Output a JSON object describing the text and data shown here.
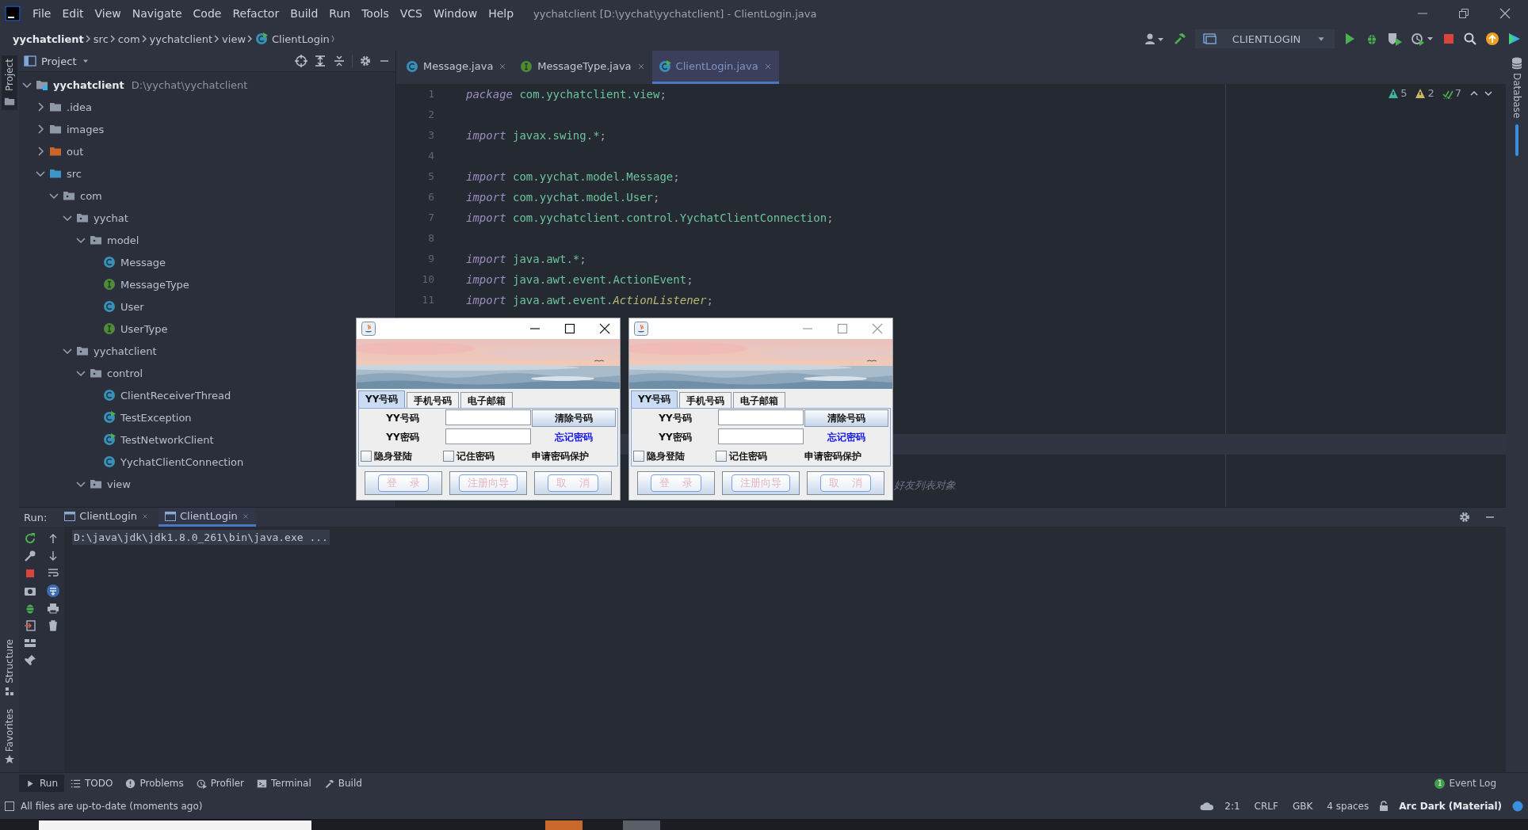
{
  "menu_bar": {
    "menus": [
      "File",
      "Edit",
      "View",
      "Navigate",
      "Code",
      "Refactor",
      "Build",
      "Run",
      "Tools",
      "VCS",
      "Window",
      "Help"
    ],
    "title": "yychatclient [D:\\yychat\\yychatclient] - ClientLogin.java"
  },
  "nav_bar": {
    "breadcrumbs": [
      {
        "label": "yychatclient",
        "kind": "module"
      },
      {
        "label": "src",
        "kind": "folder"
      },
      {
        "label": "com",
        "kind": "folder"
      },
      {
        "label": "yychatclient",
        "kind": "folder"
      },
      {
        "label": "view",
        "kind": "folder"
      },
      {
        "label": "ClientLogin",
        "kind": "runnable"
      }
    ],
    "run_config": "CLIENTLOGIN"
  },
  "left_stripe": {
    "top": [
      "Project"
    ],
    "bottom": [
      "Structure",
      "Favorites"
    ]
  },
  "right_stripe": [
    "Database"
  ],
  "project_panel": {
    "title": "Project",
    "tree": [
      {
        "label": "yychatclient",
        "path": "D:\\yychat\\yychatclient",
        "kind": "module",
        "expanded": true,
        "children": [
          {
            "label": ".idea",
            "kind": "folder",
            "expanded": false
          },
          {
            "label": "images",
            "kind": "folder",
            "expanded": false
          },
          {
            "label": "out",
            "kind": "excluded",
            "expanded": false
          },
          {
            "label": "src",
            "kind": "source",
            "expanded": true,
            "children": [
              {
                "label": "com",
                "kind": "package",
                "expanded": true,
                "children": [
                  {
                    "label": "yychat",
                    "kind": "package",
                    "expanded": true,
                    "children": [
                      {
                        "label": "model",
                        "kind": "package",
                        "expanded": true,
                        "children": [
                          {
                            "label": "Message",
                            "kind": "class"
                          },
                          {
                            "label": "MessageType",
                            "kind": "interface"
                          },
                          {
                            "label": "User",
                            "kind": "class"
                          },
                          {
                            "label": "UserType",
                            "kind": "interface"
                          }
                        ]
                      }
                    ]
                  },
                  {
                    "label": "yychatclient",
                    "kind": "package",
                    "expanded": true,
                    "children": [
                      {
                        "label": "control",
                        "kind": "package",
                        "expanded": true,
                        "children": [
                          {
                            "label": "ClientReceiverThread",
                            "kind": "class"
                          },
                          {
                            "label": "TestException",
                            "kind": "runnable"
                          },
                          {
                            "label": "TestNetworkClient",
                            "kind": "runnable"
                          },
                          {
                            "label": "YychatClientConnection",
                            "kind": "class"
                          }
                        ]
                      },
                      {
                        "label": "view",
                        "kind": "package",
                        "expanded": true
                      }
                    ]
                  }
                ]
              }
            ]
          }
        ]
      }
    ]
  },
  "editor": {
    "tabs": [
      {
        "label": "Message.java",
        "kind": "class",
        "selected": false
      },
      {
        "label": "MessageType.java",
        "kind": "interface",
        "selected": false
      },
      {
        "label": "ClientLogin.java",
        "kind": "runnable",
        "selected": true
      }
    ],
    "inspections": [
      {
        "kind": "error",
        "count": "5"
      },
      {
        "kind": "warning",
        "count": "2"
      },
      {
        "kind": "typo",
        "count": "7"
      }
    ],
    "lines": [
      {
        "number": "1",
        "tokens": [
          {
            "kind": "keyword",
            "text": "package"
          },
          {
            "kind": "ident",
            "text": " com.yychatclient.view"
          },
          {
            "kind": "punct",
            "text": ";"
          }
        ]
      },
      {
        "number": "2"
      },
      {
        "number": "3",
        "tokens": [
          {
            "kind": "keyword",
            "text": "import"
          },
          {
            "kind": "ident",
            "text": " javax.swing.*"
          },
          {
            "kind": "punct",
            "text": ";"
          }
        ]
      },
      {
        "number": "4"
      },
      {
        "number": "5",
        "tokens": [
          {
            "kind": "keyword",
            "text": "import"
          },
          {
            "kind": "ident",
            "text": " com.yychat.model.Message"
          },
          {
            "kind": "punct",
            "text": ";"
          }
        ]
      },
      {
        "number": "6",
        "tokens": [
          {
            "kind": "keyword",
            "text": "import"
          },
          {
            "kind": "ident",
            "text": " com.yychat.model.User"
          },
          {
            "kind": "punct",
            "text": ";"
          }
        ]
      },
      {
        "number": "7",
        "tokens": [
          {
            "kind": "keyword",
            "text": "import"
          },
          {
            "kind": "ident",
            "text": " com.yychatclient.control.YychatClientConnection"
          },
          {
            "kind": "punct",
            "text": ";"
          }
        ]
      },
      {
        "number": "8"
      },
      {
        "number": "9",
        "tokens": [
          {
            "kind": "keyword",
            "text": "import"
          },
          {
            "kind": "ident",
            "text": " java.awt.*"
          },
          {
            "kind": "punct",
            "text": ";"
          }
        ]
      },
      {
        "number": "10",
        "tokens": [
          {
            "kind": "keyword",
            "text": "import"
          },
          {
            "kind": "ident",
            "text": " java.awt.event.ActionEvent"
          },
          {
            "kind": "punct",
            "text": ";"
          }
        ]
      },
      {
        "number": "11",
        "tokens": [
          {
            "kind": "keyword",
            "text": "import"
          },
          {
            "kind": "ident",
            "text": " java.awt.event."
          },
          {
            "kind": "type",
            "text": "ActionListener"
          },
          {
            "kind": "punct",
            "text": ";"
          }
        ]
      }
    ],
    "comment_fragment": "好友列表对象"
  },
  "login_windows": [
    {
      "active": true,
      "tabs": [
        {
          "label": "YY号码",
          "selected": true
        },
        {
          "label": "手机号码",
          "selected": false
        },
        {
          "label": "电子邮箱",
          "selected": false
        }
      ],
      "fields": [
        {
          "label": "YY号码",
          "kind": "button",
          "action": "清除号码"
        },
        {
          "label": "YY密码",
          "kind": "link",
          "action": "忘记密码"
        }
      ],
      "options": [
        {
          "label": "隐身登陆",
          "kind": "checkbox",
          "checked": false
        },
        {
          "label": "记住密码",
          "kind": "checkbox",
          "checked": false
        },
        {
          "label": "申请密码保护",
          "kind": "text"
        }
      ],
      "buttons": [
        "登 录",
        "注册向导",
        "取 消"
      ]
    },
    {
      "active": false,
      "tabs": [
        {
          "label": "YY号码",
          "selected": true
        },
        {
          "label": "手机号码",
          "selected": false
        },
        {
          "label": "电子邮箱",
          "selected": false
        }
      ],
      "fields": [
        {
          "label": "YY号码",
          "kind": "button",
          "action": "清除号码"
        },
        {
          "label": "YY密码",
          "kind": "link",
          "action": "忘记密码"
        }
      ],
      "options": [
        {
          "label": "隐身登陆",
          "kind": "checkbox",
          "checked": false
        },
        {
          "label": "记住密码",
          "kind": "checkbox",
          "checked": false
        },
        {
          "label": "申请密码保护",
          "kind": "text"
        }
      ],
      "buttons": [
        "登 录",
        "注册向导",
        "取 消"
      ]
    }
  ],
  "run_panel": {
    "label": "Run:",
    "tabs": [
      {
        "label": "ClientLogin",
        "selected": false
      },
      {
        "label": "ClientLogin",
        "selected": true
      }
    ],
    "console": [
      "D:\\java\\jdk\\jdk1.8.0_261\\bin\\java.exe ..."
    ]
  },
  "tool_tabs": {
    "tabs": [
      {
        "label": "Run",
        "kind": "run",
        "selected": true
      },
      {
        "label": "TODO",
        "kind": "todo",
        "selected": false
      },
      {
        "label": "Problems",
        "kind": "problems",
        "selected": false
      },
      {
        "label": "Profiler",
        "kind": "profiler",
        "selected": false
      },
      {
        "label": "Terminal",
        "kind": "terminal",
        "selected": false
      },
      {
        "label": "Build",
        "kind": "build",
        "selected": false
      }
    ],
    "event_log": {
      "label": "Event Log",
      "badge": "1"
    }
  },
  "status_bar": {
    "message": "All files are up-to-date (moments ago)",
    "items": [
      "2:1",
      "CRLF",
      "GBK",
      "4 spaces"
    ],
    "theme": "Arc Dark (Material)"
  }
}
